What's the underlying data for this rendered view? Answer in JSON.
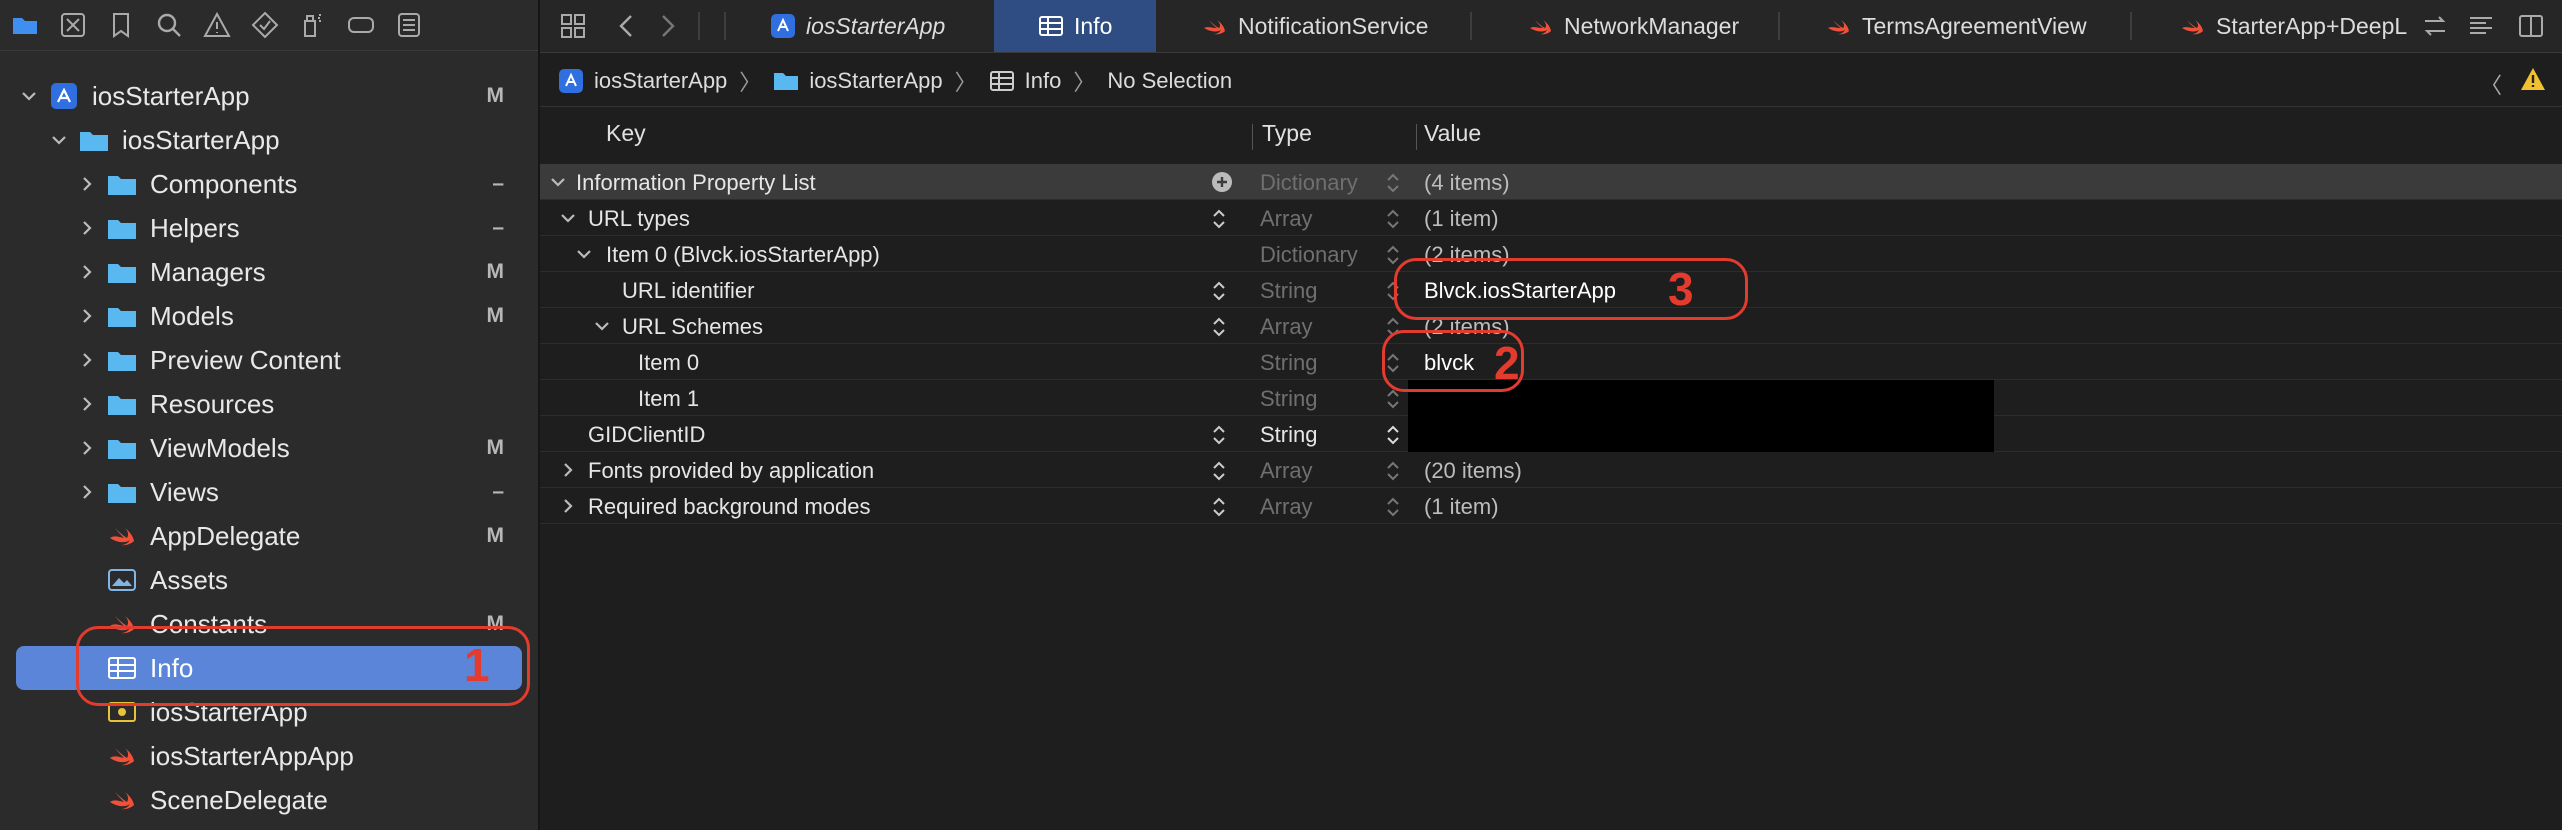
{
  "navigator": {
    "items": [
      {
        "label": "iosStarterApp",
        "badge": "M"
      },
      {
        "label": "iosStarterApp",
        "badge": ""
      },
      {
        "label": "Components",
        "badge": "–"
      },
      {
        "label": "Helpers",
        "badge": "–"
      },
      {
        "label": "Managers",
        "badge": "M"
      },
      {
        "label": "Models",
        "badge": "M"
      },
      {
        "label": "Preview Content",
        "badge": ""
      },
      {
        "label": "Resources",
        "badge": ""
      },
      {
        "label": "ViewModels",
        "badge": "M"
      },
      {
        "label": "Views",
        "badge": "–"
      },
      {
        "label": "AppDelegate",
        "badge": "M"
      },
      {
        "label": "Assets",
        "badge": ""
      },
      {
        "label": "Constants",
        "badge": "M"
      },
      {
        "label": "Info",
        "badge": ""
      },
      {
        "label": "iosStarterApp",
        "badge": ""
      },
      {
        "label": "iosStarterAppApp",
        "badge": ""
      },
      {
        "label": "SceneDelegate",
        "badge": ""
      }
    ]
  },
  "tabs": [
    "iosStarterApp",
    "Info",
    "NotificationService",
    "NetworkManager",
    "TermsAgreementView",
    "StarterApp+DeepL"
  ],
  "breadcrumb": [
    "iosStarterApp",
    "iosStarterApp",
    "Info",
    "No Selection"
  ],
  "plist": {
    "columns": {
      "key": "Key",
      "type": "Type",
      "value": "Value"
    },
    "rows": [
      {
        "key": "Information Property List",
        "type": "Dictionary",
        "value": "(4 items)"
      },
      {
        "key": "URL types",
        "type": "Array",
        "value": "(1 item)"
      },
      {
        "key": "Item 0 (Blvck.iosStarterApp)",
        "type": "Dictionary",
        "value": "(2 items)"
      },
      {
        "key": "URL identifier",
        "type": "String",
        "value": "Blvck.iosStarterApp"
      },
      {
        "key": "URL Schemes",
        "type": "Array",
        "value": "(2 items)"
      },
      {
        "key": "Item 0",
        "type": "String",
        "value": "blvck"
      },
      {
        "key": "Item 1",
        "type": "String",
        "value": ""
      },
      {
        "key": "GIDClientID",
        "type": "String",
        "value": ""
      },
      {
        "key": "Fonts provided by application",
        "type": "Array",
        "value": "(20 items)"
      },
      {
        "key": "Required background modes",
        "type": "Array",
        "value": "(1 item)"
      }
    ]
  },
  "annotations": [
    "1",
    "2",
    "3"
  ],
  "colors": {
    "selection": "#5b85d8",
    "annotation": "#e43b2f",
    "activeTab": "#2f4d82",
    "folder": "#5ab8f0",
    "swift": "#f05138"
  }
}
